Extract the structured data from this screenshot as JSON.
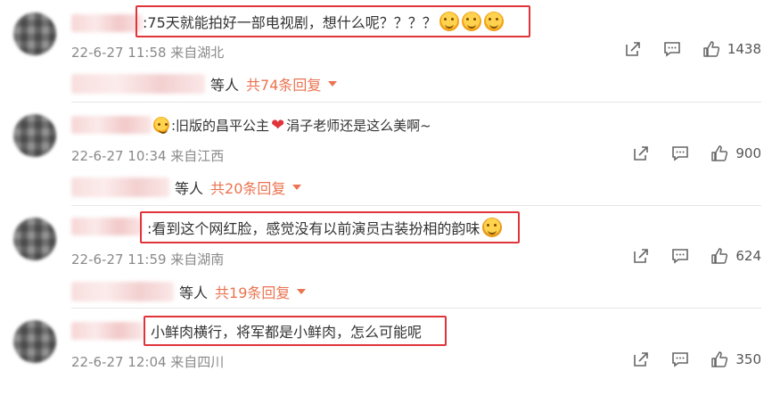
{
  "comments": [
    {
      "text": ":75天就能拍好一部电视剧，想什么呢？？？？",
      "emoji_count": 3,
      "meta": "22-6-27 11:58 来自湖北",
      "likes": "1438",
      "reply_who": "等人",
      "reply_total": "共74条回复"
    },
    {
      "prefix_icon": "heart-eyes-emoji",
      "text_a": ":旧版的昌平公主",
      "text_b": "涓子老师还是这么美啊~",
      "meta": "22-6-27 10:34 来自江西",
      "likes": "900",
      "reply_who": "等人",
      "reply_total": "共20条回复"
    },
    {
      "text": ":看到这个网红脸，感觉没有以前演员古装扮相的韵味",
      "meta": "22-6-27 11:59 来自湖南",
      "likes": "624",
      "reply_who": "等人",
      "reply_total": "共19条回复"
    },
    {
      "text": "小鲜肉横行，将军都是小鲜肉，怎么可能呢",
      "meta": "22-6-27 12:04 来自四川",
      "likes": "350"
    }
  ],
  "colors": {
    "highlight_border": "#e0343b",
    "reply_link": "#eb7350",
    "meta_gray": "#8a8a8a"
  },
  "icons": {
    "share": "share-icon",
    "comment": "comment-icon",
    "like": "thumbs-up-icon"
  }
}
